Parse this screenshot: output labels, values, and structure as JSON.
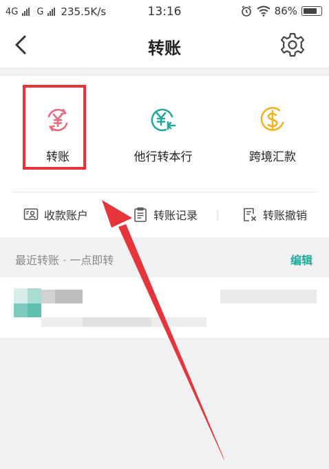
{
  "status_bar": {
    "network1": "4G",
    "network2": "G",
    "speed": "235.5K/s",
    "time": "13:16",
    "battery": "86%",
    "battery_level": 0.86
  },
  "nav": {
    "title": "转账",
    "back_icon": "chevron-left-icon",
    "settings_icon": "gear-icon"
  },
  "tools": [
    {
      "label": "转账",
      "icon": "yuan-transfer-icon",
      "color": "#e8697a"
    },
    {
      "label": "他行转本行",
      "icon": "yuan-return-icon",
      "color": "#23a99a"
    },
    {
      "label": "跨境汇款",
      "icon": "dollar-coin-icon",
      "color": "#f2b31e"
    }
  ],
  "links": [
    {
      "label": "收款账户",
      "icon": "payee-account-icon"
    },
    {
      "label": "转账记录",
      "icon": "clipboard-record-icon"
    },
    {
      "label": "转账撤销",
      "icon": "document-cancel-icon"
    }
  ],
  "recent": {
    "title": "最近转账 · 一点即转",
    "edit_label": "编辑"
  },
  "colors": {
    "accent": "#23a99a",
    "highlight": "#e5343a",
    "transfer": "#e8697a",
    "crossborder": "#f2b31e"
  }
}
